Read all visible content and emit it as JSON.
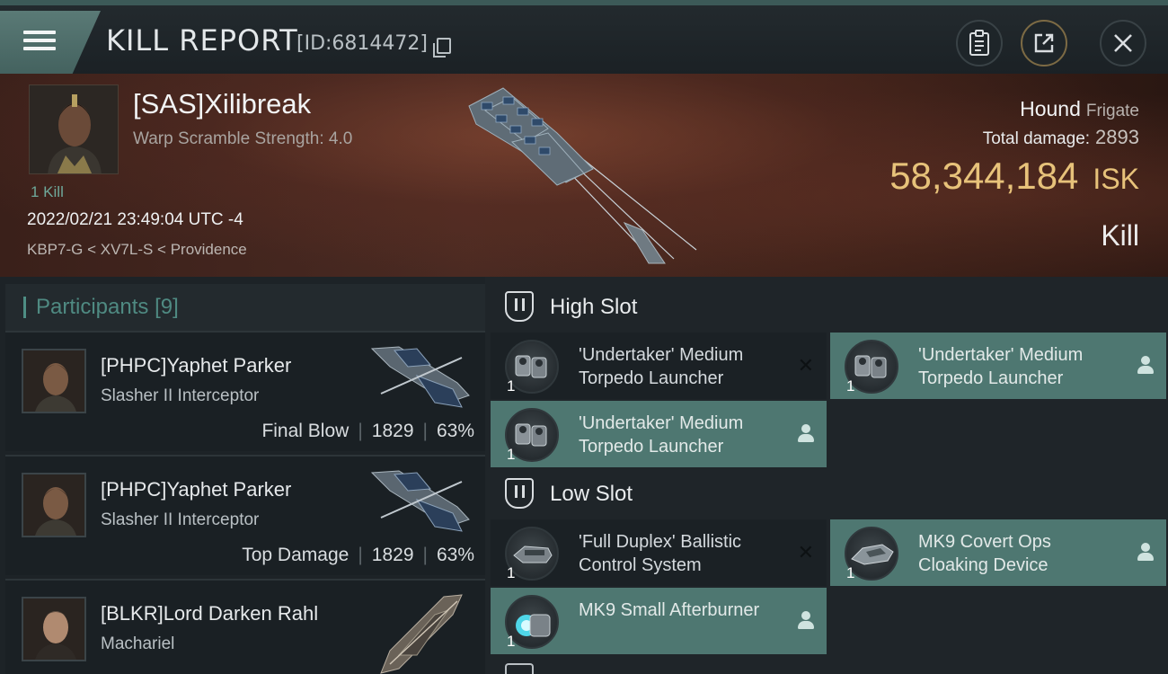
{
  "titlebar": {
    "title": "KILL REPORT",
    "id_text": "[ID:6814472]"
  },
  "victim": {
    "name": "[SAS]Xilibreak",
    "scramble": "Warp Scramble Strength: 4.0",
    "kills": "1 Kill",
    "time": "2022/02/21 23:49:04 UTC -4",
    "location": "KBP7-G < XV7L-S < Providence",
    "ship_name": "Hound",
    "ship_class": "Frigate",
    "total_damage_label": "Total damage:",
    "total_damage": "2893",
    "isk_value": "58,344,184",
    "isk_unit": "ISK",
    "result": "Kill"
  },
  "participants": {
    "title": "Participants",
    "count": "[9]",
    "items": [
      {
        "name": "[PHPC]Yaphet Parker",
        "ship": "Slasher II Interceptor",
        "role": "Final Blow",
        "damage": "1829",
        "percent": "63%"
      },
      {
        "name": "[PHPC]Yaphet Parker",
        "ship": "Slasher II Interceptor",
        "role": "Top Damage",
        "damage": "1829",
        "percent": "63%"
      },
      {
        "name": "[BLKR]Lord Darken Rahl",
        "ship": "Machariel"
      }
    ]
  },
  "fittings": {
    "high_slot": {
      "title": "High Slot",
      "modules": [
        {
          "name": "'Undertaker' Medium Torpedo Launcher",
          "qty": "1",
          "state": "destroyed"
        },
        {
          "name": "'Undertaker' Medium Torpedo Launcher",
          "qty": "1",
          "state": "dropped"
        },
        {
          "name": "'Undertaker' Medium Torpedo Launcher",
          "qty": "1",
          "state": "dropped"
        }
      ]
    },
    "low_slot": {
      "title": "Low Slot",
      "modules": [
        {
          "name": "'Full Duplex' Ballistic Control System",
          "qty": "1",
          "state": "destroyed"
        },
        {
          "name": "MK9 Covert Ops Cloaking Device",
          "qty": "1",
          "state": "dropped"
        },
        {
          "name": "MK9 Small Afterburner",
          "qty": "1",
          "state": "dropped"
        }
      ]
    }
  },
  "colors": {
    "accent": "#4e7771",
    "isk": "#e7c27a",
    "teal_text": "#4f8a82"
  }
}
